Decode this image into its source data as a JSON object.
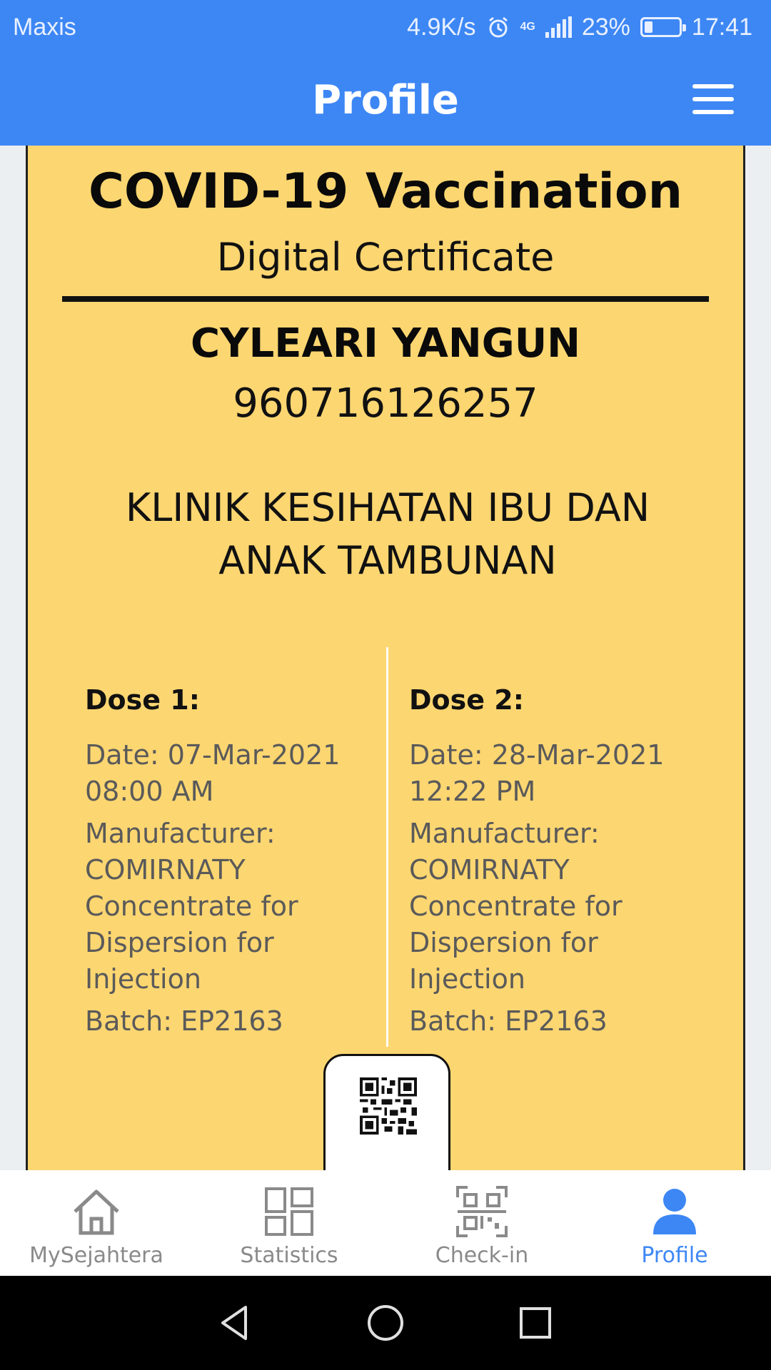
{
  "status_bar": {
    "carrier": "Maxis",
    "speed": "4.9K/s",
    "network": "4G",
    "battery_percent": "23%",
    "battery_level": 0.23,
    "time": "17:41"
  },
  "app_bar": {
    "title": "Profile",
    "menu_icon": "hamburger-menu-icon"
  },
  "certificate": {
    "title": "COVID-19 Vaccination",
    "subtitle": "Digital Certificate",
    "name": "CYLEARI YANGUN",
    "id_number": "960716126257",
    "facility_line1": "KLINIK KESIHATAN IBU DAN",
    "facility_line2": "ANAK TAMBUNAN",
    "doses": [
      {
        "heading": "Dose 1:",
        "date_line1": "Date: 07-Mar-2021",
        "date_line2": "08:00 AM",
        "manufacturer_label": "Manufacturer:",
        "manufacturer_lines": [
          "COMIRNATY",
          "Concentrate for",
          "Dispersion for",
          "Injection"
        ],
        "batch": "Batch: EP2163"
      },
      {
        "heading": "Dose 2:",
        "date_line1": "Date: 28-Mar-2021",
        "date_line2": "12:22 PM",
        "manufacturer_label": "Manufacturer:",
        "manufacturer_lines": [
          "COMIRNATY",
          "Concentrate for",
          "Dispersion for",
          "Injection"
        ],
        "batch": "Batch: EP2163"
      }
    ]
  },
  "bottom_nav": {
    "items": [
      {
        "label": "MySejahtera",
        "icon": "home-icon",
        "active": false
      },
      {
        "label": "Statistics",
        "icon": "grid-icon",
        "active": false
      },
      {
        "label": "Check-in",
        "icon": "qr-scan-icon",
        "active": false
      },
      {
        "label": "Profile",
        "icon": "person-icon",
        "active": true
      }
    ]
  },
  "colors": {
    "primary": "#3d87f5",
    "card": "#fcd671",
    "inactive": "#8a8a8a"
  }
}
